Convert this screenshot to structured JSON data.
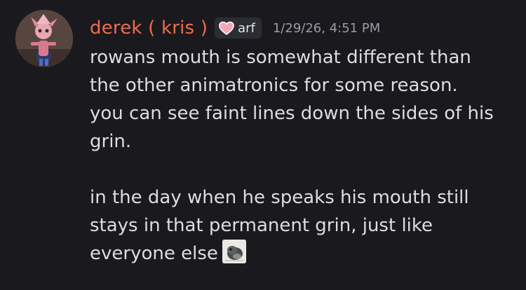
{
  "message": {
    "author": "derek ( kris )",
    "tag": {
      "icon": "heart-icon",
      "label": "arf",
      "icon_color": "#f6a5b5"
    },
    "timestamp": "1/29/26, 4:51 PM",
    "lines": [
      "rowans mouth is somewhat different than",
      "the other animatronics for some reason.",
      "you can see faint lines down the sides of his",
      "grin.",
      "",
      "in the day when he speaks his mouth still",
      "stays in that permanent grin, just like",
      "everyone else"
    ],
    "emoji": "custom-emoji-icon"
  },
  "colors": {
    "background": "#1a1a1e",
    "author": "#ee6c4f",
    "text": "#dcdde1",
    "timestamp": "#9a9ca6",
    "tag_bg": "#2c2d33"
  }
}
